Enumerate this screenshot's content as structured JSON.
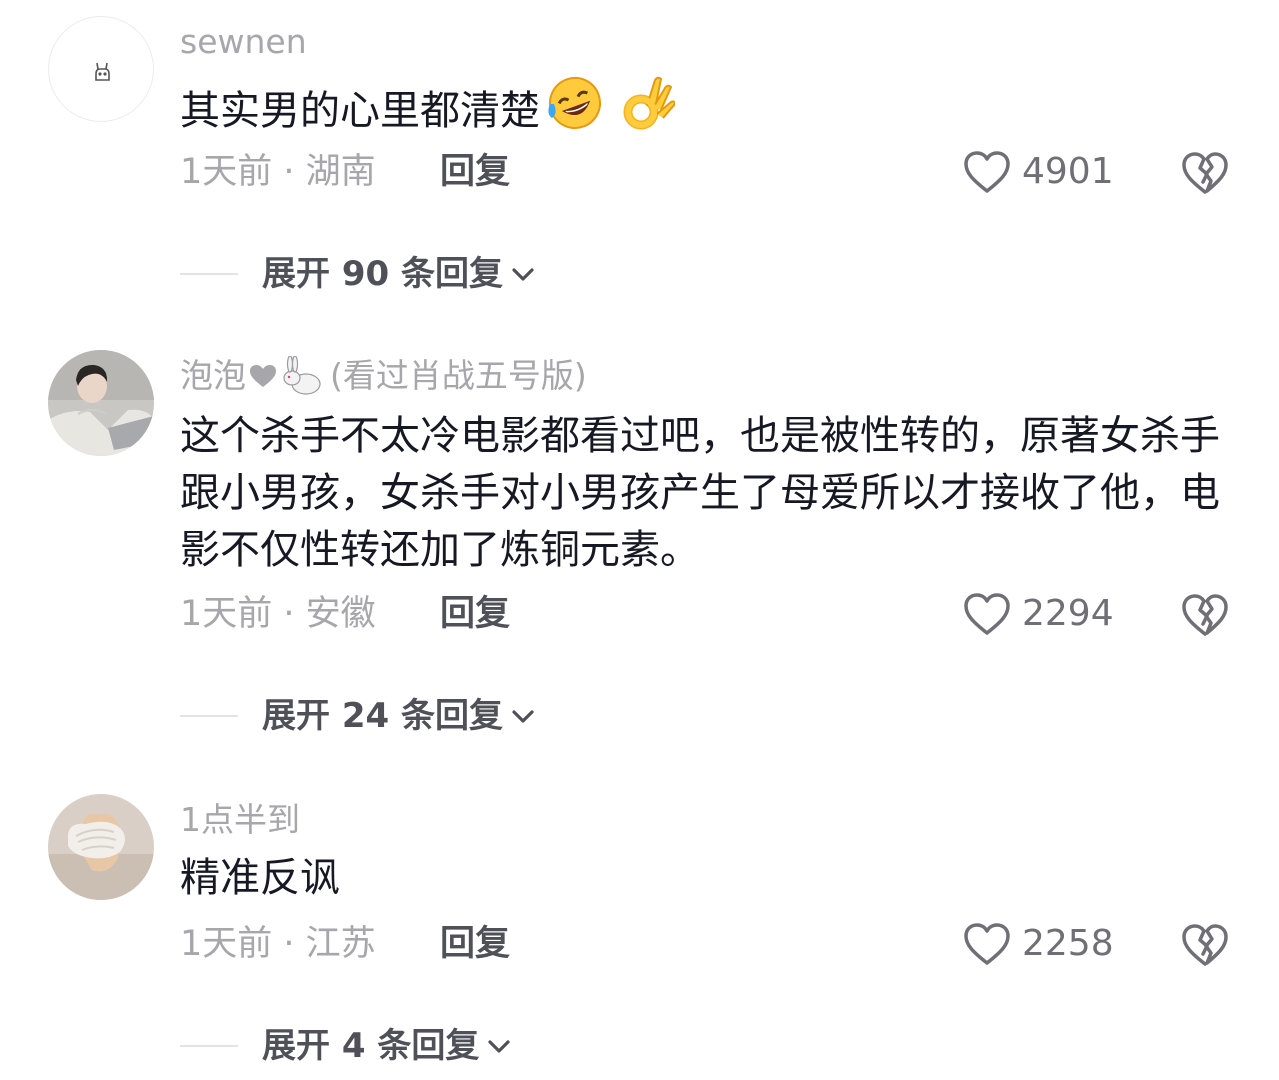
{
  "comments": [
    {
      "username": "sewnen",
      "text": "其实男的心里都清楚",
      "emojis": [
        "rofl-emoji",
        "ok-hand-emoji"
      ],
      "time": "1天前 · 湖南",
      "reply_label": "回复",
      "likes": "4901",
      "expand_label": "展开 90 条回复"
    },
    {
      "username": "泡泡",
      "username_suffix": "(看过肖战五号版)",
      "username_icons": [
        "heart-icon",
        "rabbit-icon"
      ],
      "text": "这个杀手不太冷电影都看过吧，也是被性转的，原著女杀手跟小男孩，女杀手对小男孩产生了母爱所以才接收了他，电影不仅性转还加了炼铜元素。",
      "time": "1天前 · 安徽",
      "reply_label": "回复",
      "likes": "2294",
      "expand_label": "展开 24 条回复"
    },
    {
      "username": "1点半到",
      "text": "精准反讽",
      "time": "1天前 · 江苏",
      "reply_label": "回复",
      "likes": "2258",
      "expand_label": "展开 4 条回复"
    }
  ],
  "colors": {
    "text_primary": "#161823",
    "text_secondary": "#a6a6ab",
    "text_action": "#505058",
    "divider": "#e3e3e6",
    "icon": "#6f6f75"
  }
}
